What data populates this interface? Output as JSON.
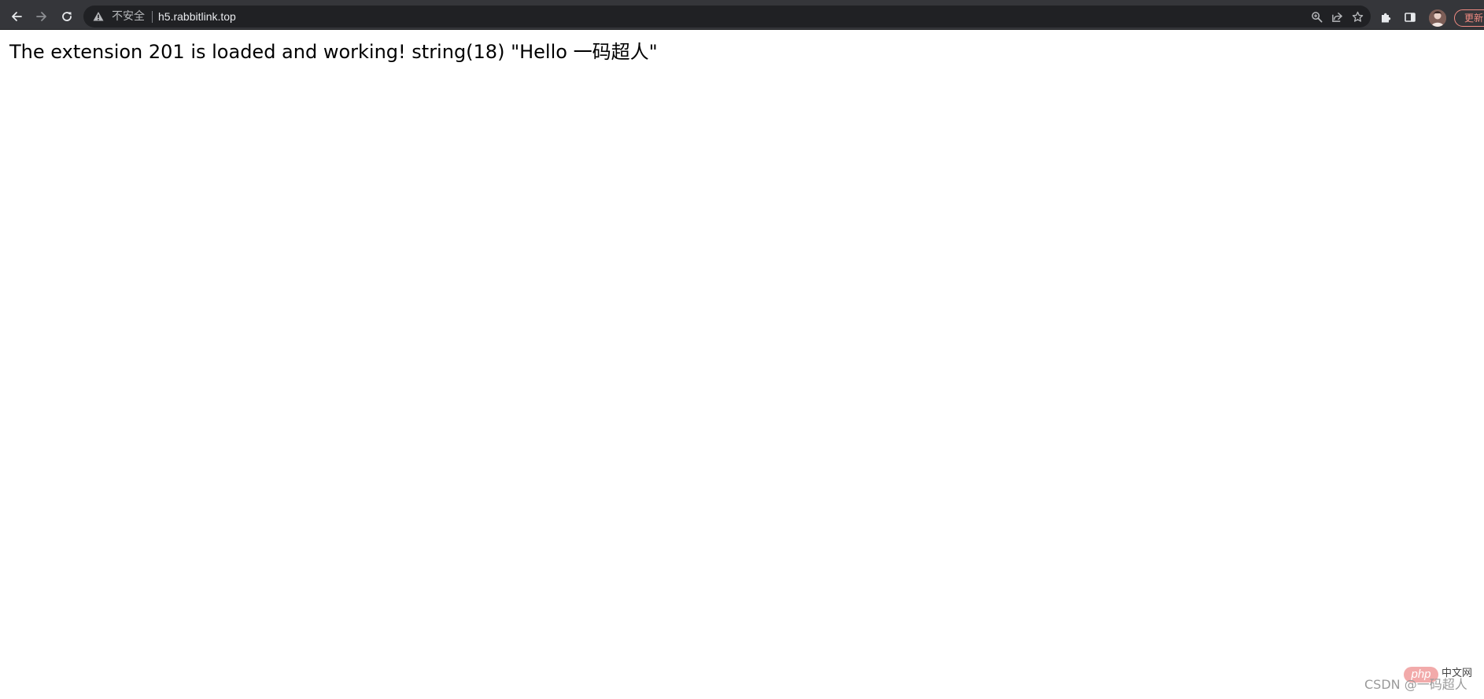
{
  "browser": {
    "security_label": "不安全",
    "url": "h5.rabbitlink.top",
    "update_button_label": "更新",
    "icons": {
      "back": "back-arrow-icon",
      "forward": "forward-arrow-icon",
      "reload": "reload-icon",
      "warning": "warning-icon",
      "zoom": "zoom-icon",
      "share": "share-icon",
      "bookmark": "star-icon",
      "extensions": "puzzle-icon",
      "side_panel": "side-panel-icon",
      "profile": "avatar"
    },
    "colors": {
      "toolbar": "#35363a",
      "omnibox": "#202124",
      "update_accent": "#f28b82"
    }
  },
  "page": {
    "content_text": "The extension 201 is loaded and working! string(18) \"Hello 一码超人\""
  },
  "watermark": {
    "php_badge": "php",
    "php_cn": "中文网",
    "csdn": "CSDN @一码超人"
  }
}
